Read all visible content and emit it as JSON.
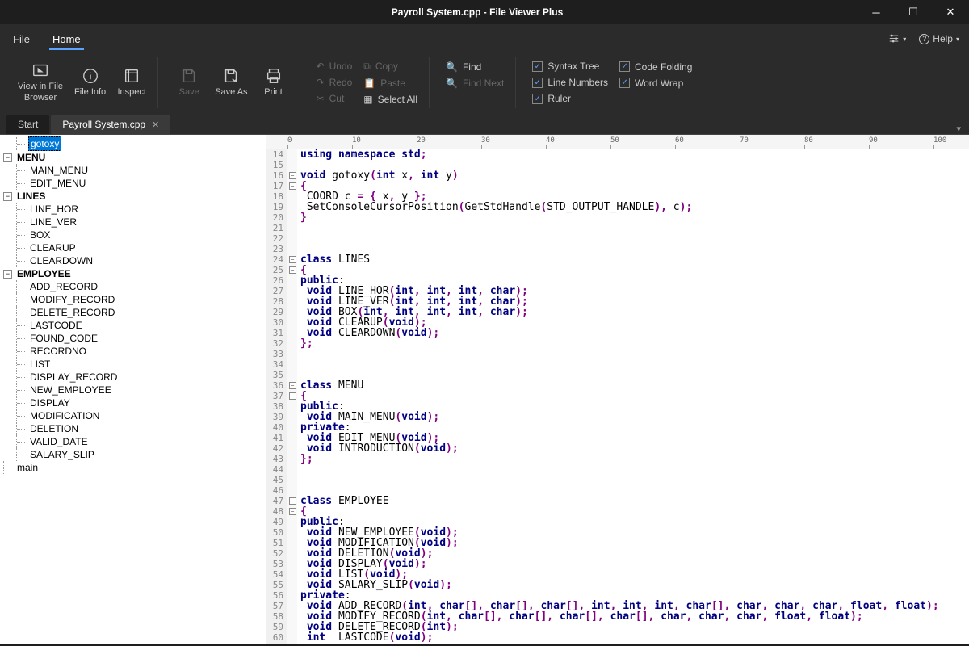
{
  "titlebar": {
    "title": "Payroll System.cpp - File Viewer Plus"
  },
  "menubar": {
    "file": "File",
    "home": "Home",
    "help": "Help"
  },
  "ribbon": {
    "view_in_file_browser": "View in File\nBrowser",
    "file_info": "File Info",
    "inspect": "Inspect",
    "save": "Save",
    "save_as": "Save As",
    "print": "Print",
    "undo": "Undo",
    "redo": "Redo",
    "cut": "Cut",
    "copy": "Copy",
    "paste": "Paste",
    "select_all": "Select All",
    "find": "Find",
    "find_next": "Find Next",
    "syntax_tree": "Syntax Tree",
    "line_numbers": "Line Numbers",
    "ruler": "Ruler",
    "code_folding": "Code Folding",
    "word_wrap": "Word Wrap"
  },
  "tabs": {
    "start": "Start",
    "active": "Payroll System.cpp"
  },
  "tree": {
    "root": "gotoxy",
    "menu": "MENU",
    "menu_items": [
      "MAIN_MENU",
      "EDIT_MENU"
    ],
    "lines": "LINES",
    "lines_items": [
      "LINE_HOR",
      "LINE_VER",
      "BOX",
      "CLEARUP",
      "CLEARDOWN"
    ],
    "employee": "EMPLOYEE",
    "employee_items": [
      "ADD_RECORD",
      "MODIFY_RECORD",
      "DELETE_RECORD",
      "LASTCODE",
      "FOUND_CODE",
      "RECORDNO",
      "LIST",
      "DISPLAY_RECORD",
      "NEW_EMPLOYEE",
      "DISPLAY",
      "MODIFICATION",
      "DELETION",
      "VALID_DATE",
      "SALARY_SLIP"
    ],
    "main": "main"
  },
  "ruler_marks": [
    0,
    10,
    20,
    30,
    40,
    50,
    60,
    70,
    80,
    90,
    100
  ],
  "code_lines": [
    {
      "n": 14,
      "fold": "",
      "raw": "using namespace std;"
    },
    {
      "n": 15,
      "fold": "",
      "raw": ""
    },
    {
      "n": 16,
      "fold": "box",
      "raw": "void gotoxy(int x, int y)"
    },
    {
      "n": 17,
      "fold": "box",
      "raw": "{"
    },
    {
      "n": 18,
      "fold": "",
      "raw": " COORD c = { x, y };"
    },
    {
      "n": 19,
      "fold": "",
      "raw": " SetConsoleCursorPosition(GetStdHandle(STD_OUTPUT_HANDLE), c);"
    },
    {
      "n": 20,
      "fold": "",
      "raw": "}"
    },
    {
      "n": 21,
      "fold": "",
      "raw": ""
    },
    {
      "n": 22,
      "fold": "",
      "raw": ""
    },
    {
      "n": 23,
      "fold": "",
      "raw": ""
    },
    {
      "n": 24,
      "fold": "box",
      "raw": "class LINES"
    },
    {
      "n": 25,
      "fold": "box",
      "raw": "{"
    },
    {
      "n": 26,
      "fold": "",
      "raw": "public:"
    },
    {
      "n": 27,
      "fold": "",
      "raw": " void LINE_HOR(int, int, int, char);"
    },
    {
      "n": 28,
      "fold": "",
      "raw": " void LINE_VER(int, int, int, char);"
    },
    {
      "n": 29,
      "fold": "",
      "raw": " void BOX(int, int, int, int, char);"
    },
    {
      "n": 30,
      "fold": "",
      "raw": " void CLEARUP(void);"
    },
    {
      "n": 31,
      "fold": "",
      "raw": " void CLEARDOWN(void);"
    },
    {
      "n": 32,
      "fold": "",
      "raw": "};"
    },
    {
      "n": 33,
      "fold": "",
      "raw": ""
    },
    {
      "n": 34,
      "fold": "",
      "raw": ""
    },
    {
      "n": 35,
      "fold": "",
      "raw": ""
    },
    {
      "n": 36,
      "fold": "box",
      "raw": "class MENU"
    },
    {
      "n": 37,
      "fold": "box",
      "raw": "{"
    },
    {
      "n": 38,
      "fold": "",
      "raw": "public:"
    },
    {
      "n": 39,
      "fold": "",
      "raw": " void MAIN_MENU(void);"
    },
    {
      "n": 40,
      "fold": "",
      "raw": "private:"
    },
    {
      "n": 41,
      "fold": "",
      "raw": " void EDIT_MENU(void);"
    },
    {
      "n": 42,
      "fold": "",
      "raw": " void INTRODUCTION(void);"
    },
    {
      "n": 43,
      "fold": "",
      "raw": "};"
    },
    {
      "n": 44,
      "fold": "",
      "raw": ""
    },
    {
      "n": 45,
      "fold": "",
      "raw": ""
    },
    {
      "n": 46,
      "fold": "",
      "raw": ""
    },
    {
      "n": 47,
      "fold": "box",
      "raw": "class EMPLOYEE"
    },
    {
      "n": 48,
      "fold": "box",
      "raw": "{"
    },
    {
      "n": 49,
      "fold": "",
      "raw": "public:"
    },
    {
      "n": 50,
      "fold": "",
      "raw": " void NEW_EMPLOYEE(void);"
    },
    {
      "n": 51,
      "fold": "",
      "raw": " void MODIFICATION(void);"
    },
    {
      "n": 52,
      "fold": "",
      "raw": " void DELETION(void);"
    },
    {
      "n": 53,
      "fold": "",
      "raw": " void DISPLAY(void);"
    },
    {
      "n": 54,
      "fold": "",
      "raw": " void LIST(void);"
    },
    {
      "n": 55,
      "fold": "",
      "raw": " void SALARY_SLIP(void);"
    },
    {
      "n": 56,
      "fold": "",
      "raw": "private:"
    },
    {
      "n": 57,
      "fold": "",
      "raw": " void ADD_RECORD(int, char[], char[], char[], int, int, int, char[], char, char, char, float, float);"
    },
    {
      "n": 58,
      "fold": "",
      "raw": " void MODIFY_RECORD(int, char[], char[], char[], char[], char, char, char, float, float);"
    },
    {
      "n": 59,
      "fold": "",
      "raw": " void DELETE_RECORD(int);"
    },
    {
      "n": 60,
      "fold": "",
      "raw": " int  LASTCODE(void);"
    }
  ]
}
